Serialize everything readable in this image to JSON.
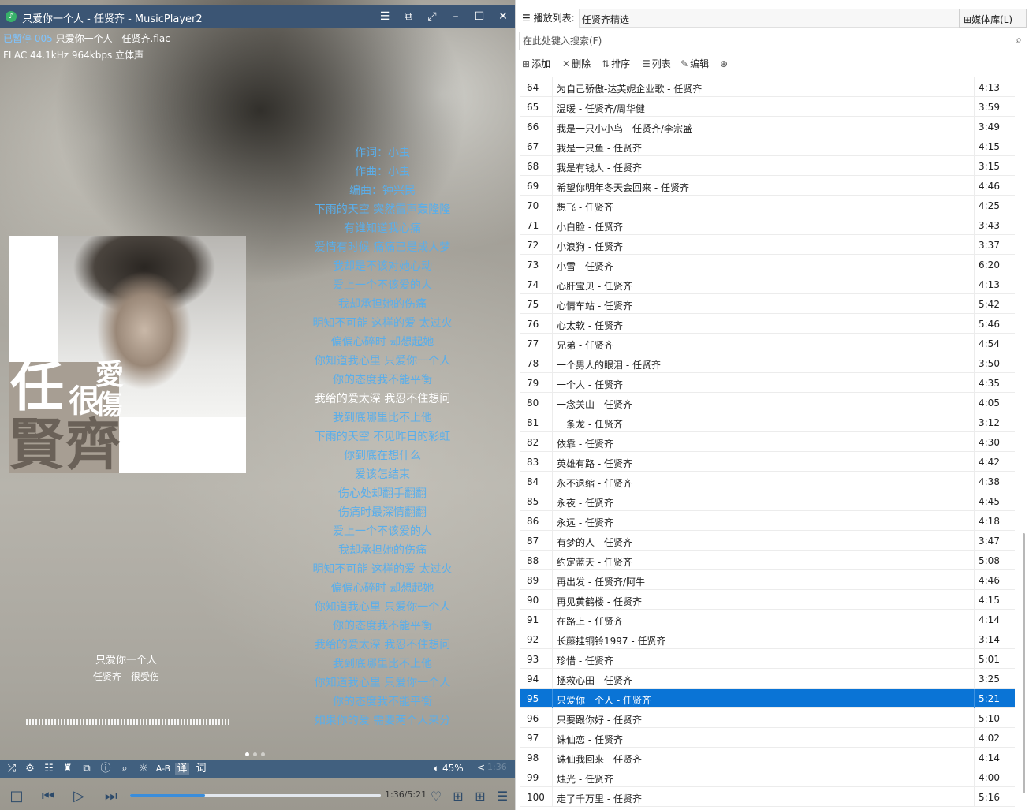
{
  "window": {
    "title": "只爱你一个人 - 任贤齐 - MusicPlayer2",
    "app_icon": "music-note-icon"
  },
  "titlebar_buttons": [
    "menu-icon",
    "mini-mode-icon",
    "fullscreen-icon",
    "minimize-icon",
    "maximize-icon",
    "close-icon"
  ],
  "now_playing": {
    "status": "已暂停",
    "status_extra": "005",
    "file": "只爱你一个人 - 任贤齐.flac",
    "format": "FLAC 44.1kHz 964kbps 立体声",
    "song_title": "只爱你一个人",
    "artist_album": "任贤齐 - 很受伤",
    "cover_text": [
      "任",
      "賢",
      "齊",
      "很",
      "愛",
      "傷"
    ]
  },
  "lyrics": [
    "作词：小虫",
    "作曲：小虫",
    "编曲：钟兴民",
    "下雨的天空 突然雷声轰隆隆",
    "有谁知道我心痛",
    "爱情有时候 痛痛已是成人梦",
    "我却是不该对她心动",
    "爱上一个不该爱的人",
    "我却承担她的伤痛",
    "明知不可能 这样的爱 太过火",
    "偏偏心碎时 却想起她",
    "你知道我心里 只爱你一个人",
    "你的态度我不能平衡",
    "我给的爱太深 我忍不住想问",
    "我到底哪里比不上他",
    "下雨的天空 不见昨日的彩虹",
    "你到底在想什么",
    "爱该怎结束",
    "伤心处却翻手翻翻",
    "伤痛时最深情翻翻",
    "爱上一个不该爱的人",
    "我却承担她的伤痛",
    "明知不可能 这样的爱 太过火",
    "偏偏心碎时 却想起她",
    "你知道我心里 只爱你一个人",
    "你的态度我不能平衡",
    "我给的爱太深 我忍不住想问",
    "我到底哪里比不上他",
    "你知道我心里 只爱你一个人",
    "你的态度我不能平衡",
    "如果你的爱 需要两个人来分"
  ],
  "current_lyric_index": 13,
  "controls": {
    "icons": [
      "shuffle-icon",
      "settings-icon",
      "equalizer-icon",
      "skin-icon",
      "mini-mode-icon",
      "info-icon",
      "search-icon",
      "brightness-icon"
    ],
    "ab_label": "A-B",
    "translate_label": "译",
    "lyrics_label": "词",
    "volume_icon": "speaker-icon",
    "volume": "45%",
    "arrow": "<",
    "faint_text": "1:36"
  },
  "transport": {
    "buttons": [
      "stop-icon",
      "previous-icon",
      "play-icon",
      "next-icon"
    ],
    "time": "1:36/5:21",
    "progress": 0.299,
    "right_icons": [
      "favorite-icon",
      "add-to-playlist-icon",
      "grid-icon",
      "playlist-icon"
    ]
  },
  "playlist": {
    "label": "播放列表:",
    "name": "任贤齐精选",
    "media_button": "媒体库(L)",
    "search_placeholder": "在此处键入搜索(F)",
    "tools": [
      "添加",
      "删除",
      "排序",
      "列表",
      "编辑"
    ],
    "selected_index": 31,
    "selected_color": "#0a74d6",
    "rows": [
      {
        "num": "64",
        "name": "为自己骄傲-达芙妮企业歌 - 任贤齐",
        "dur": "4:13"
      },
      {
        "num": "65",
        "name": "温暖 - 任贤齐/周华健",
        "dur": "3:59"
      },
      {
        "num": "66",
        "name": "我是一只小小鸟 - 任贤齐/李宗盛",
        "dur": "3:49"
      },
      {
        "num": "67",
        "name": "我是一只鱼 - 任贤齐",
        "dur": "4:15"
      },
      {
        "num": "68",
        "name": "我是有钱人 - 任贤齐",
        "dur": "3:15"
      },
      {
        "num": "69",
        "name": "希望你明年冬天会回来 - 任贤齐",
        "dur": "4:46"
      },
      {
        "num": "70",
        "name": "想飞 - 任贤齐",
        "dur": "4:25"
      },
      {
        "num": "71",
        "name": "小白脸 - 任贤齐",
        "dur": "3:43"
      },
      {
        "num": "72",
        "name": "小浪狗 - 任贤齐",
        "dur": "3:37"
      },
      {
        "num": "73",
        "name": "小雪 - 任贤齐",
        "dur": "6:20"
      },
      {
        "num": "74",
        "name": "心肝宝贝 - 任贤齐",
        "dur": "4:13"
      },
      {
        "num": "75",
        "name": "心情车站 - 任贤齐",
        "dur": "5:42"
      },
      {
        "num": "76",
        "name": "心太软 - 任贤齐",
        "dur": "5:46"
      },
      {
        "num": "77",
        "name": "兄弟 - 任贤齐",
        "dur": "4:54"
      },
      {
        "num": "78",
        "name": "一个男人的眼泪 - 任贤齐",
        "dur": "3:50"
      },
      {
        "num": "79",
        "name": "一个人 - 任贤齐",
        "dur": "4:35"
      },
      {
        "num": "80",
        "name": "一念关山 - 任贤齐",
        "dur": "4:05"
      },
      {
        "num": "81",
        "name": "一条龙 - 任贤齐",
        "dur": "3:12"
      },
      {
        "num": "82",
        "name": "依靠 - 任贤齐",
        "dur": "4:30"
      },
      {
        "num": "83",
        "name": "英雄有路 - 任贤齐",
        "dur": "4:42"
      },
      {
        "num": "84",
        "name": "永不退缩 - 任贤齐",
        "dur": "4:38"
      },
      {
        "num": "85",
        "name": "永夜 - 任贤齐",
        "dur": "4:45"
      },
      {
        "num": "86",
        "name": "永远 - 任贤齐",
        "dur": "4:18"
      },
      {
        "num": "87",
        "name": "有梦的人 - 任贤齐",
        "dur": "3:47"
      },
      {
        "num": "88",
        "name": "约定蓝天 - 任贤齐",
        "dur": "5:08"
      },
      {
        "num": "89",
        "name": "再出发 - 任贤齐/阿牛",
        "dur": "4:46"
      },
      {
        "num": "90",
        "name": "再见黄鹤楼 - 任贤齐",
        "dur": "4:15"
      },
      {
        "num": "91",
        "name": "在路上 - 任贤齐",
        "dur": "4:14"
      },
      {
        "num": "92",
        "name": "长藤挂铜铃1997 - 任贤齐",
        "dur": "3:14"
      },
      {
        "num": "93",
        "name": "珍惜 - 任贤齐",
        "dur": "5:01"
      },
      {
        "num": "94",
        "name": "拯救心田 - 任贤齐",
        "dur": "3:25"
      },
      {
        "num": "95",
        "name": "只爱你一个人 - 任贤齐",
        "dur": "5:21"
      },
      {
        "num": "96",
        "name": "只要跟你好 - 任贤齐",
        "dur": "5:10"
      },
      {
        "num": "97",
        "name": "诛仙恋 - 任贤齐",
        "dur": "4:02"
      },
      {
        "num": "98",
        "name": "诛仙我回来 - 任贤齐",
        "dur": "4:14"
      },
      {
        "num": "99",
        "name": "烛光 - 任贤齐",
        "dur": "4:00"
      },
      {
        "num": "100",
        "name": "走了千万里 - 任贤齐",
        "dur": "5:16"
      }
    ]
  }
}
